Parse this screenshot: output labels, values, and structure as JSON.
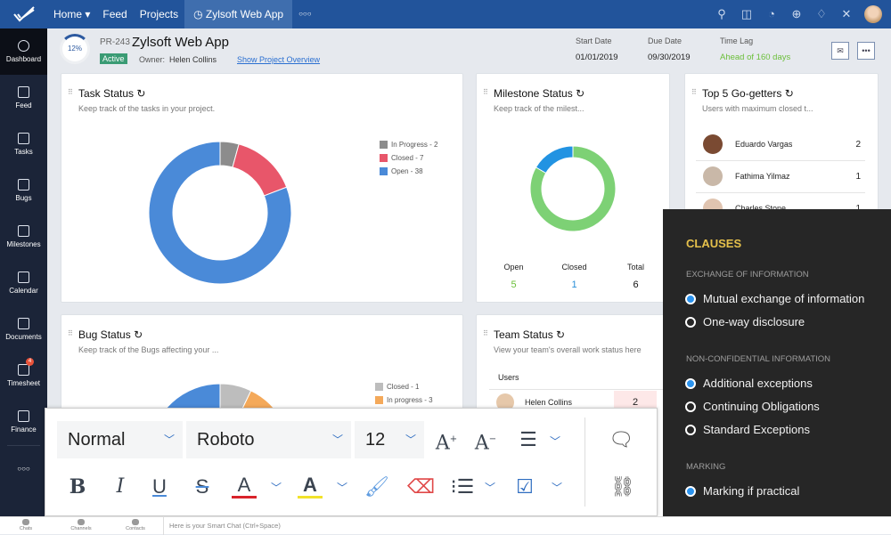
{
  "topbar": {
    "nav": [
      "Home ▾",
      "Feed",
      "Projects"
    ],
    "active_tab": "Zylsoft Web App",
    "more": "○○○",
    "icons": [
      "search-icon",
      "gamepad-icon",
      "timer-icon",
      "plus-circle-icon",
      "bell-icon",
      "tools-icon",
      "avatar"
    ]
  },
  "sidebar": {
    "items": [
      {
        "label": "Dashboard",
        "icon": "gauge-icon"
      },
      {
        "label": "Feed",
        "icon": "feed-icon"
      },
      {
        "label": "Tasks",
        "icon": "clipboard-check-icon"
      },
      {
        "label": "Bugs",
        "icon": "bug-icon"
      },
      {
        "label": "Milestones",
        "icon": "signpost-icon"
      },
      {
        "label": "Calendar",
        "icon": "calendar-icon"
      },
      {
        "label": "Documents",
        "icon": "folder-icon"
      },
      {
        "label": "Timesheet",
        "icon": "clock-icon",
        "badge": "4"
      },
      {
        "label": "Finance",
        "icon": "invoice-icon"
      }
    ],
    "more": "○○○"
  },
  "project": {
    "progress": "12%",
    "progress_value": 12,
    "id": "PR-243",
    "title": "Zylsoft Web App",
    "status": "Active",
    "owner_label": "Owner:",
    "owner": "Helen Collins",
    "overview_link": "Show Project Overview",
    "start_label": "Start Date",
    "start": "01/01/2019",
    "due_label": "Due Date",
    "due": "09/30/2019",
    "lag_label": "Time Lag",
    "lag": "Ahead of 160 days",
    "more": "•••"
  },
  "colors": {
    "accent": "#22549b",
    "gray": "#8c8c8c",
    "red": "#e8566a",
    "blue": "#4a8ad8",
    "green": "#7dd175",
    "milestone_blue": "#2293e2",
    "orange": "#f4a95a",
    "lag_green": "#6bbf3a",
    "clauses": "#e5c04b"
  },
  "task_status": {
    "title": "Task Status",
    "subtitle": "Keep track of the tasks in your project.",
    "legend": [
      "In Progress - 2",
      "Closed - 7",
      "Open - 38"
    ]
  },
  "milestone_status": {
    "title": "Milestone Status",
    "subtitle": "Keep track of the milest...",
    "stats": [
      {
        "label": "Open",
        "value": "5"
      },
      {
        "label": "Closed",
        "value": "1"
      },
      {
        "label": "Total",
        "value": "6"
      }
    ]
  },
  "go_getters": {
    "title": "Top 5 Go-getters",
    "subtitle": "Users with maximum closed t...",
    "users": [
      {
        "name": "Eduardo Vargas",
        "count": "2"
      },
      {
        "name": "Fathima Yilmaz",
        "count": "1"
      },
      {
        "name": "Charles Stone",
        "count": "1"
      }
    ]
  },
  "bug_status": {
    "title": "Bug Status",
    "subtitle": "Keep track of the Bugs affecting your ...",
    "legend": [
      "Closed - 1",
      "In progress - 3"
    ]
  },
  "team_status": {
    "title": "Team Status",
    "subtitle": "View your team's overall work status here",
    "col_users": "Users",
    "rows": [
      {
        "name": "Helen Collins",
        "count": "2"
      }
    ]
  },
  "chart_data": [
    {
      "type": "pie",
      "title": "Task Status",
      "categories": [
        "In Progress",
        "Closed",
        "Open"
      ],
      "values": [
        2,
        7,
        38
      ],
      "donut": true
    },
    {
      "type": "pie",
      "title": "Milestone Status",
      "categories": [
        "Closed",
        "Open"
      ],
      "values": [
        1,
        5
      ],
      "donut": true
    },
    {
      "type": "pie",
      "title": "Bug Status",
      "categories": [
        "Closed",
        "In progress"
      ],
      "values": [
        1,
        3
      ]
    }
  ],
  "toolbar": {
    "style": "Normal",
    "font": "Roboto",
    "size": "12",
    "buttons": [
      "font-increase-icon",
      "font-decrease-icon",
      "align-left-icon",
      "bold-icon",
      "italic-icon",
      "underline-icon",
      "strikethrough-icon",
      "text-color-icon",
      "highlight-icon",
      "format-painter-icon",
      "clear-format-icon",
      "list-icon",
      "checkbox-icon",
      "add-comment-icon",
      "link-icon"
    ]
  },
  "clauses": {
    "title": "CLAUSES",
    "groups": [
      {
        "heading": "EXCHANGE OF INFORMATION",
        "options": [
          {
            "label": "Mutual exchange of information",
            "checked": true
          },
          {
            "label": "One-way disclosure",
            "checked": false
          }
        ]
      },
      {
        "heading": "NON-CONFIDENTIAL INFORMATION",
        "options": [
          {
            "label": "Additional exceptions",
            "checked": true
          },
          {
            "label": "Continuing Obligations",
            "checked": false
          },
          {
            "label": "Standard Exceptions",
            "checked": false
          }
        ]
      },
      {
        "heading": "MARKING",
        "options": [
          {
            "label": "Marking if practical",
            "checked": true
          }
        ]
      }
    ]
  },
  "bottombar": {
    "items": [
      "Chats",
      "Channels",
      "Contacts"
    ],
    "chat_placeholder": "Here is your Smart Chat (Ctrl+Space)"
  }
}
